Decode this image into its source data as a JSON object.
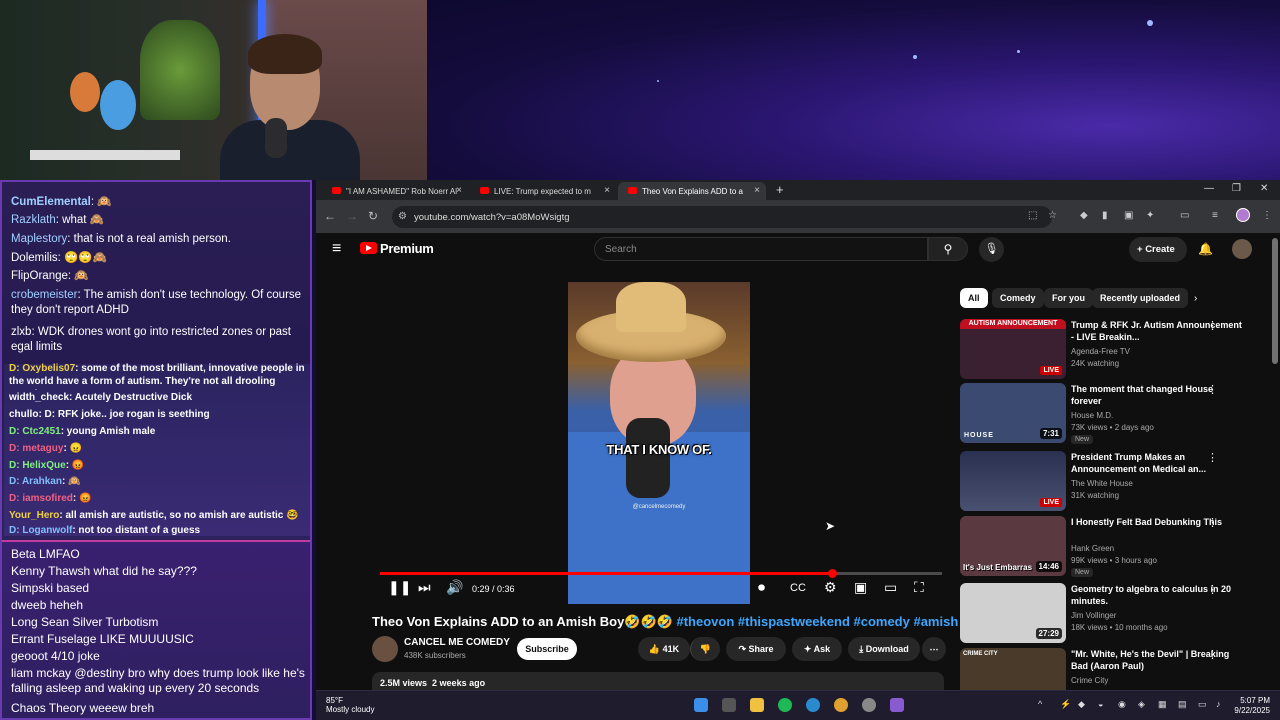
{
  "chat": {
    "top": [
      {
        "user": "CumElemental",
        "color": "#a0d0ff",
        "msg": ": 🙉"
      },
      {
        "user": "Razklath",
        "color": "#a0d0ff",
        "msg": ": what 🙈"
      },
      {
        "user": "Maplestory",
        "color": "#a0d0ff",
        "msg": ": that is not a real amish person."
      },
      {
        "user": "Dolemilis",
        "color": "#ffffff",
        "msg": ": 🙄🙄🙈"
      },
      {
        "user": "FlipOrange",
        "color": "#ffffff",
        "msg": ": 🙉"
      },
      {
        "user": "crobemeister",
        "color": "#a0d0ff",
        "msg": ": The amish don't use technology. Of course they don't report ADHD"
      },
      {
        "user": "zlxb",
        "color": "#ffffff",
        "msg": ": WDK drones wont go into restricted zones or past egal limits"
      }
    ],
    "mid": [
      {
        "user": "D: Oxybelis07",
        "color": "#f0d040",
        "msg": ": some of the most brilliant, innovative people in the world have a form of autism. They're not all drooling retards"
      },
      {
        "user": "width_check",
        "color": "#ffffff",
        "msg": ": Acutely Destructive Dick"
      },
      {
        "user": "chullo",
        "color": "#ffffff",
        "msg": ": D: RFK joke.. joe rogan is seething"
      },
      {
        "user": "D: Ctc2451",
        "color": "#80f080",
        "msg": ": young Amish male"
      },
      {
        "user": "D: metaguy",
        "color": "#f06080",
        "msg": ": 😠"
      },
      {
        "user": "D: HelixQue",
        "color": "#80f080",
        "msg": ": 😡"
      },
      {
        "user": "D: Arahkan",
        "color": "#80c0ff",
        "msg": ": 🙉"
      },
      {
        "user": "D: iamsofired",
        "color": "#f06080",
        "msg": ": 😡"
      },
      {
        "user": "Your_Hero",
        "color": "#f0d040",
        "msg": ": all amish are autistic, so no amish are autistic 🤓"
      },
      {
        "user": "D: Loganwolf",
        "color": "#80c0ff",
        "msg": ": not too distant of a guess"
      }
    ],
    "bottom": [
      {
        "user": "Beta",
        "msg": " LMFAO"
      },
      {
        "user": "Kenny Thawsh",
        "msg": " what did he say???"
      },
      {
        "user": "Simpski",
        "msg": " based"
      },
      {
        "user": "dweeb",
        "msg": " heheh"
      },
      {
        "user": "Long Sean Silver",
        "msg": " Turbotism"
      },
      {
        "user": "Errant Fuselage",
        "msg": " LIKE MUUUUSIC"
      },
      {
        "user": "geooot",
        "msg": " 4/10 joke"
      },
      {
        "user": "liam mckay",
        "msg": " @destiny bro why does trump look like he's falling asleep and waking up every 20 seconds"
      },
      {
        "user": "Chaos Theory",
        "msg": " weeew breh"
      }
    ]
  },
  "browser": {
    "tabs": [
      {
        "label": "\"I AM ASHAMED\" Rob Noerr Al"
      },
      {
        "label": "LIVE: Trump expected to m"
      },
      {
        "label": "Theo Von Explains ADD to a"
      }
    ],
    "url": "youtube.com/watch?v=a08MoWsigtg"
  },
  "youtube": {
    "brand": "Premium",
    "search_placeholder": "Search",
    "create_label": "Create",
    "video": {
      "caption": "THAT I KNOW OF.",
      "watermark": "@cancelmecomedy",
      "time": "0:29 / 0:36",
      "progress": 0.805,
      "title_main": "Theo Von Explains ADD to an Amish Boy🤣🤣🤣 ",
      "title_tags": "#theovon #thispastweekend #comedy #amish",
      "channel": "CANCEL ME COMEDY",
      "subscribers": "438K subscribers",
      "subscribe_label": "Subscribe",
      "likes": "41K",
      "share_label": "Share",
      "ask_label": "Ask",
      "download_label": "Download",
      "views": "2.5M views",
      "age": "2 weeks ago"
    },
    "chips": [
      "All",
      "Comedy",
      "For you",
      "Recently uploaded"
    ],
    "recommendations": [
      {
        "title": "Trump & RFK Jr. Autism Announcement - LIVE Breakin...",
        "channel": "Agenda-Free TV",
        "meta": "24K watching",
        "badge": "LIVE",
        "thumb_text": "AUTISM ANNOUNCEMENT",
        "thumb": "#3a2030"
      },
      {
        "title": "The moment that changed House forever",
        "channel": "House M.D.",
        "meta": "73K views • 2 days ago",
        "badge": "7:31",
        "new": "New",
        "thumb_text": "HOUSE",
        "thumb": "#3a4a70"
      },
      {
        "title": "President Trump Makes an Announcement on Medical an...",
        "channel": "The White House",
        "meta": "31K watching",
        "badge": "LIVE",
        "thumb_text": "",
        "thumb": "#2a3050"
      },
      {
        "title": "I Honestly Felt Bad Debunking This",
        "channel": "Hank Green",
        "meta": "99K views • 3 hours ago",
        "badge": "14:46",
        "new": "New",
        "thumb_text": "It's Just Embarras",
        "thumb": "#5a3a40"
      },
      {
        "title": "Geometry to algebra to calculus in 20 minutes.",
        "channel": "Jim Vollinger",
        "meta": "18K views • 10 months ago",
        "badge": "27:29",
        "thumb_text": "",
        "thumb": "#d0d0d0"
      },
      {
        "title": "\"Mr. White, He's the Devil\" | Breaking Bad (Aaron Paul)",
        "channel": "Crime City",
        "meta": "",
        "badge": "",
        "thumb_text": "CRIME CITY",
        "thumb": "#4a3a2a"
      }
    ]
  },
  "taskbar": {
    "temp": "85°F",
    "weather": "Mostly cloudy",
    "time": "5:07 PM",
    "date": "9/22/2025"
  }
}
